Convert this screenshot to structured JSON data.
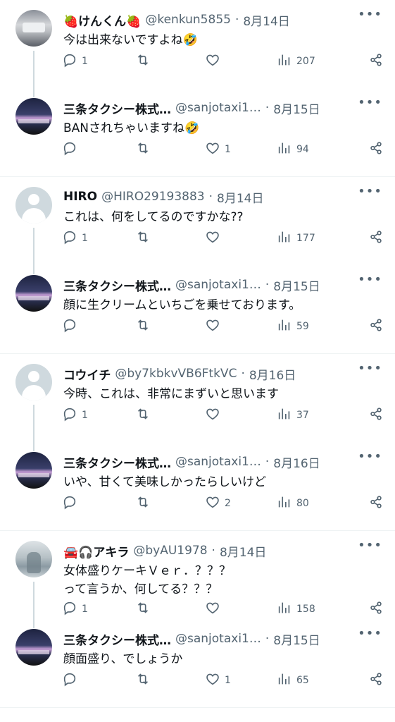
{
  "threads": [
    {
      "tweets": [
        {
          "name": "🍓けんくん🍓",
          "handle": "@kenkun5855",
          "dot": "·",
          "date": "8月14日",
          "text": "今は出来ないですよね🤣",
          "replies": "1",
          "retweets": "",
          "likes": "",
          "views": "207",
          "avatar": "photo-train"
        },
        {
          "name": "三条タクシー株式…",
          "handle": "@sanjotaxi1…",
          "dot": "·",
          "date": "8月15日",
          "text": "BANされちゃいますね🤣",
          "replies": "",
          "retweets": "",
          "likes": "1",
          "views": "94",
          "avatar": "photo-taxi"
        }
      ]
    },
    {
      "tweets": [
        {
          "name": "HIRO",
          "handle": "@HIRO29193883",
          "dot": "·",
          "date": "8月14日",
          "text": "これは、何をしてるのですかな??",
          "replies": "1",
          "retweets": "",
          "likes": "",
          "views": "177",
          "avatar": "default-avatar"
        },
        {
          "name": "三条タクシー株式…",
          "handle": "@sanjotaxi1…",
          "dot": "·",
          "date": "8月15日",
          "text": "顔に生クリームといちごを乗せております。",
          "replies": "",
          "retweets": "",
          "likes": "",
          "views": "59",
          "avatar": "photo-taxi"
        }
      ]
    },
    {
      "tweets": [
        {
          "name": "コウイチ",
          "handle": "@by7kbkvVB6FtkVC",
          "dot": "·",
          "date": "8月16日",
          "text": "今時、これは、非常にまずいと思います",
          "replies": "1",
          "retweets": "",
          "likes": "",
          "views": "37",
          "avatar": "default-avatar"
        },
        {
          "name": "三条タクシー株式…",
          "handle": "@sanjotaxi1…",
          "dot": "·",
          "date": "8月16日",
          "text": "いや、甘くて美味しかったらしいけど",
          "replies": "",
          "retweets": "",
          "likes": "2",
          "views": "80",
          "avatar": "photo-taxi"
        }
      ]
    },
    {
      "tweets": [
        {
          "name": "🚘🎧アキラ",
          "handle": "@byAU1978",
          "dot": "·",
          "date": "8月14日",
          "text": "女体盛りケーキＶｅｒ．？？？\nって言うか、何してる？？？",
          "replies": "1",
          "retweets": "",
          "likes": "",
          "views": "158",
          "avatar": "photo-person"
        },
        {
          "name": "三条タクシー株式…",
          "handle": "@sanjotaxi1…",
          "dot": "·",
          "date": "8月15日",
          "text": "顔面盛り、でしょうか",
          "replies": "",
          "retweets": "",
          "likes": "1",
          "views": "65",
          "avatar": "photo-taxi"
        }
      ]
    }
  ],
  "colors": {
    "text": "#0f1419",
    "secondary": "#536471",
    "divider": "#eff3f4",
    "thread_line": "#cfd9de"
  },
  "icons": {
    "reply": "reply-icon",
    "retweet": "retweet-icon",
    "like": "like-icon",
    "views": "views-icon",
    "share": "share-icon",
    "more": "more-icon"
  }
}
